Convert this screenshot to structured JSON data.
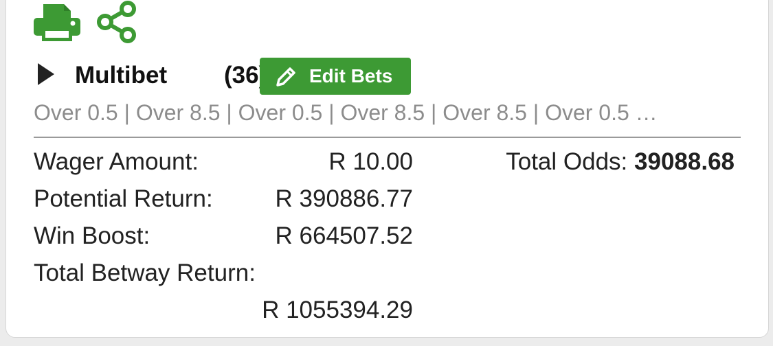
{
  "colors": {
    "accent": "#3d9a34",
    "text": "#222222",
    "muted": "#8c8c8c"
  },
  "actions": {
    "print_icon": "printer-icon",
    "share_icon": "share-icon"
  },
  "bet": {
    "title": "Multibet",
    "count": "(36)",
    "edit_label": "Edit Bets",
    "selections": "Over 0.5 | Over 8.5 | Over 0.5 | Over 8.5 | Over 8.5 | Over 0.5 …"
  },
  "summary": {
    "wager_label": "Wager Amount:",
    "wager_value": "R 10.00",
    "potential_label": "Potential Return:",
    "potential_value": "R 390886.77",
    "boost_label": "Win Boost:",
    "boost_value": "R 664507.52",
    "total_label": "Total Betway Return:",
    "total_value": "R 1055394.29",
    "odds_label": "Total Odds:",
    "odds_value": "39088.68"
  }
}
